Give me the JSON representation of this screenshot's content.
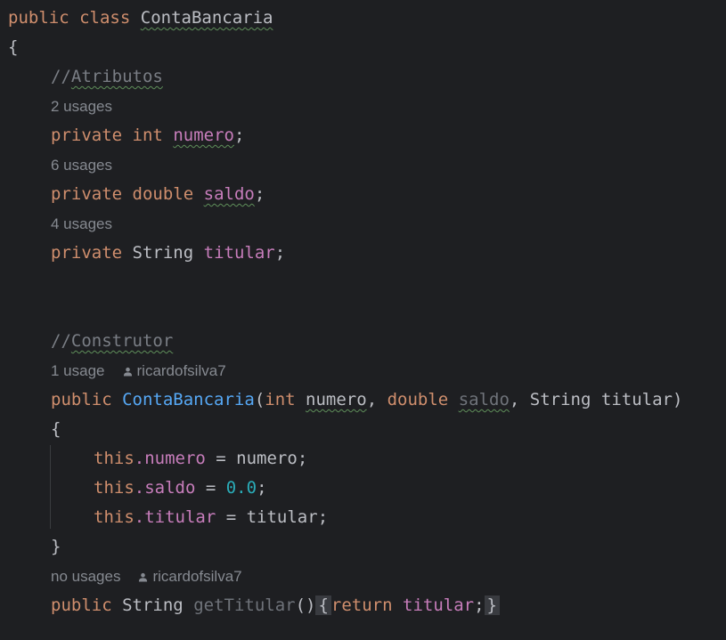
{
  "code": {
    "line1": {
      "kw_public": "public",
      "kw_class": "class",
      "class_name": "ContaBancaria"
    },
    "open_brace": "{",
    "comment_attributes": "//Atributos",
    "usages_numero": "2 usages",
    "field_numero": {
      "kw_private": "private",
      "type": "int",
      "name": "numero",
      "semi": ";"
    },
    "usages_saldo": "6 usages",
    "field_saldo": {
      "kw_private": "private",
      "type": "double",
      "name": "saldo",
      "semi": ";"
    },
    "usages_titular": "4 usages",
    "field_titular": {
      "kw_private": "private",
      "type": "String",
      "name": "titular",
      "semi": ";"
    },
    "comment_constructor": "//Construtor",
    "constructor_hint": {
      "usages": "1 usage",
      "author": "ricardofsilva7"
    },
    "constructor_sig": {
      "kw_public": "public",
      "name": "ContaBancaria",
      "open_paren": "(",
      "p1_type": "int",
      "p1_name": "numero",
      "comma1": ",",
      "p2_type": "double",
      "p2_name": "saldo",
      "comma2": ",",
      "p3_type": "String",
      "p3_name": "titular",
      "close_paren": ")"
    },
    "ctor_open": "{",
    "stmt1": {
      "this": "this",
      "field": ".numero",
      "op": " = ",
      "value": "numero",
      "semi": ";"
    },
    "stmt2": {
      "this": "this",
      "field": ".saldo",
      "op": " = ",
      "value": "0.0",
      "semi": ";"
    },
    "stmt3": {
      "this": "this",
      "field": ".titular",
      "op": " = ",
      "value": "titular",
      "semi": ";"
    },
    "ctor_close": "}",
    "getter_hint": {
      "usages": "no usages",
      "author": "ricardofsilva7"
    },
    "getter": {
      "kw_public": "public",
      "type": "String",
      "name": "getTitular",
      "parens": "()",
      "fold_open": "{",
      "kw_return": "return",
      "field": "titular",
      "semi": ";",
      "fold_close": "}"
    }
  },
  "colors": {
    "background": "#1e1f22",
    "keyword": "#cf8e6d",
    "field": "#c77dbb",
    "function": "#56a8f5",
    "number": "#2aacb8",
    "comment": "#7a7e85",
    "hint": "#868a91"
  }
}
